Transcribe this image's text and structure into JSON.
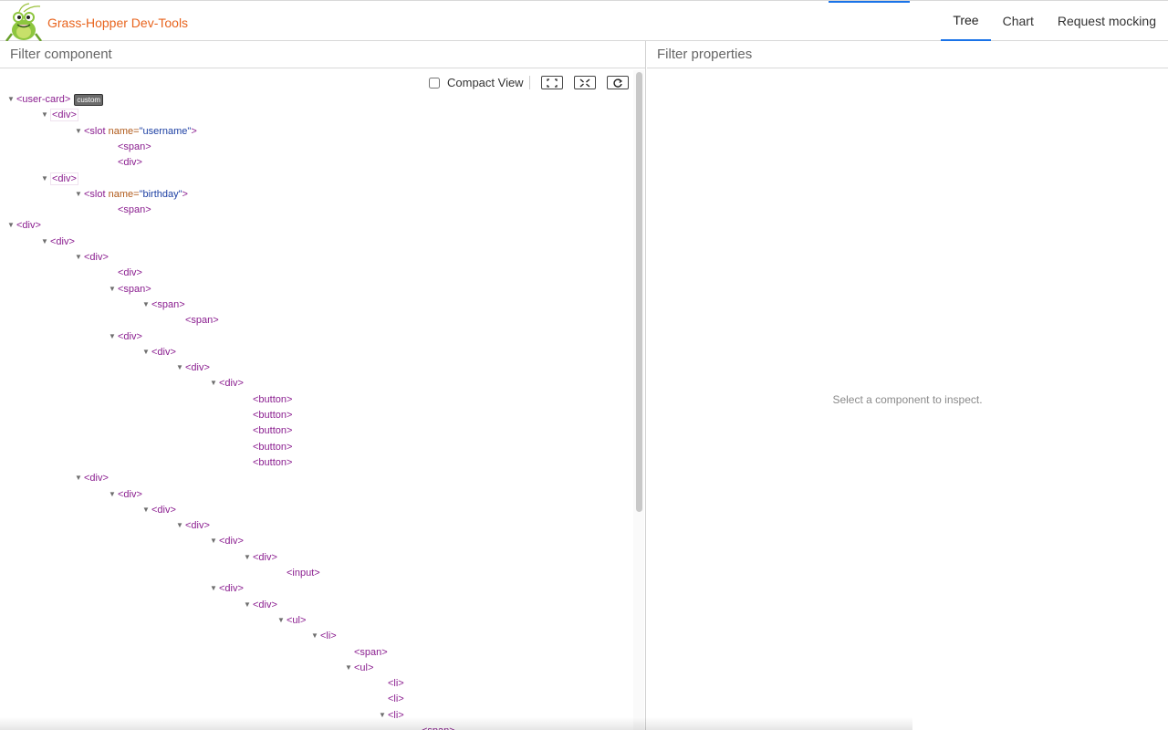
{
  "app": {
    "title": "Grass-Hopper Dev-Tools",
    "accent": "#e8641e",
    "tab_accent": "#1a73e8"
  },
  "tabs": [
    {
      "label": "Tree",
      "active": true
    },
    {
      "label": "Chart",
      "active": false
    },
    {
      "label": "Request mocking",
      "active": false
    }
  ],
  "left": {
    "filter_placeholder": "Filter component",
    "toolbar": {
      "compact_label": "Compact View",
      "compact_checked": false,
      "icons": [
        "expand-all-icon",
        "collapse-all-icon",
        "refresh-icon"
      ]
    }
  },
  "right": {
    "filter_placeholder": "Filter properties",
    "empty_message": "Select a component to inspect."
  },
  "tree": [
    {
      "text": "<user-card>",
      "depth": 0,
      "arrow": true,
      "badge": "custom"
    },
    {
      "text": "<div>",
      "depth": 1,
      "arrow": true,
      "boxed": true
    },
    {
      "text": "<slot",
      "depth": 2,
      "arrow": true,
      "attr": "name",
      "val": "username"
    },
    {
      "text": "<span>",
      "depth": 3,
      "arrow": false
    },
    {
      "text": "<div>",
      "depth": 3,
      "arrow": false
    },
    {
      "text": "<div>",
      "depth": 1,
      "arrow": true,
      "boxed": true
    },
    {
      "text": "<slot",
      "depth": 2,
      "arrow": true,
      "attr": "name",
      "val": "birthday"
    },
    {
      "text": "<span>",
      "depth": 3,
      "arrow": false
    },
    {
      "text": "<div>",
      "depth": 0,
      "arrow": true
    },
    {
      "text": "<div>",
      "depth": 1,
      "arrow": true
    },
    {
      "text": "<div>",
      "depth": 2,
      "arrow": true
    },
    {
      "text": "<div>",
      "depth": 3,
      "arrow": false
    },
    {
      "text": "<span>",
      "depth": 3,
      "arrow": true
    },
    {
      "text": "<span>",
      "depth": 4,
      "arrow": true
    },
    {
      "text": "<span>",
      "depth": 5,
      "arrow": false
    },
    {
      "text": "<div>",
      "depth": 3,
      "arrow": true
    },
    {
      "text": "<div>",
      "depth": 4,
      "arrow": true
    },
    {
      "text": "<div>",
      "depth": 5,
      "arrow": true
    },
    {
      "text": "<div>",
      "depth": 6,
      "arrow": true
    },
    {
      "text": "<button>",
      "depth": 7,
      "arrow": false
    },
    {
      "text": "<button>",
      "depth": 7,
      "arrow": false
    },
    {
      "text": "<button>",
      "depth": 7,
      "arrow": false
    },
    {
      "text": "<button>",
      "depth": 7,
      "arrow": false
    },
    {
      "text": "<button>",
      "depth": 7,
      "arrow": false
    },
    {
      "text": "<div>",
      "depth": 2,
      "arrow": true
    },
    {
      "text": "<div>",
      "depth": 3,
      "arrow": true
    },
    {
      "text": "<div>",
      "depth": 4,
      "arrow": true
    },
    {
      "text": "<div>",
      "depth": 5,
      "arrow": true
    },
    {
      "text": "<div>",
      "depth": 6,
      "arrow": true
    },
    {
      "text": "<div>",
      "depth": 7,
      "arrow": true
    },
    {
      "text": "<input>",
      "depth": 8,
      "arrow": false
    },
    {
      "text": "<div>",
      "depth": 6,
      "arrow": true
    },
    {
      "text": "<div>",
      "depth": 7,
      "arrow": true
    },
    {
      "text": "<ul>",
      "depth": 8,
      "arrow": true
    },
    {
      "text": "<li>",
      "depth": 9,
      "arrow": true
    },
    {
      "text": "<span>",
      "depth": 10,
      "arrow": false
    },
    {
      "text": "<ul>",
      "depth": 10,
      "arrow": true
    },
    {
      "text": "<li>",
      "depth": 11,
      "arrow": false
    },
    {
      "text": "<li>",
      "depth": 11,
      "arrow": false
    },
    {
      "text": "<li>",
      "depth": 11,
      "arrow": true
    },
    {
      "text": "<span>",
      "depth": 12,
      "arrow": false
    }
  ]
}
